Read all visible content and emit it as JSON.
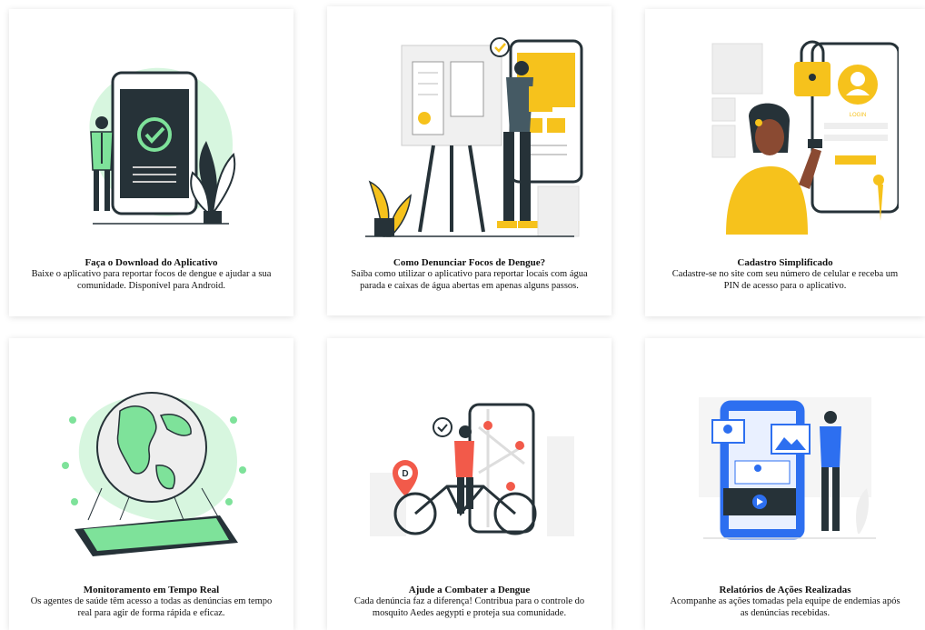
{
  "colors": {
    "card_bg": "#ffffff",
    "green": "#7ee29a",
    "green_light": "#d7f6df",
    "yellow": "#f6c21c",
    "red": "#f25a4a",
    "blue": "#2d6ff0",
    "dark": "#263238"
  },
  "cards": [
    {
      "title": "Faça o Download do Aplicativo",
      "description": "Baixe o aplicativo para reportar focos de dengue e ajudar a sua comunidade. Disponível para Android.",
      "icon": "phone-download-illustration"
    },
    {
      "title": "Como Denunciar Focos de Dengue?",
      "description": "Saiba como utilizar o aplicativo para reportar locais com água parada e caixas de água abertas em apenas alguns passos.",
      "icon": "report-guide-illustration"
    },
    {
      "title": "Cadastro Simplificado",
      "description": "Cadastre-se no site com seu número de celular e receba um PIN de acesso para o aplicativo.",
      "icon": "login-phone-illustration",
      "login_label": "LOGIN"
    },
    {
      "title": "Monitoramento em Tempo Real",
      "description": "Os agentes de saúde têm acesso a todas as denúncias em tempo real para agir de forma rápida e eficaz.",
      "icon": "globe-tablet-illustration"
    },
    {
      "title": "Ajude a Combater a Dengue",
      "description": "Cada denúncia faz a diferença! Contribua para o controle do mosquito Aedes aegypti e proteja sua comunidade.",
      "icon": "bicycle-map-illustration",
      "pin_letter": "D"
    },
    {
      "title": "Relatórios de Ações Realizadas",
      "description": "Acompanhe as ações tomadas pela equipe de endemias após as denúncias recebidas.",
      "icon": "reports-phone-illustration"
    }
  ]
}
